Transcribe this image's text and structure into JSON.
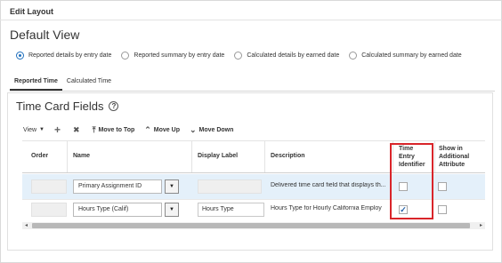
{
  "page": {
    "title": "Edit Layout",
    "view_title": "Default View"
  },
  "view_options": [
    {
      "label": "Reported details by entry date",
      "selected": true
    },
    {
      "label": "Reported summary by entry date",
      "selected": false
    },
    {
      "label": "Calculated details by earned date",
      "selected": false
    },
    {
      "label": "Calculated summary by earned date",
      "selected": false
    }
  ],
  "tabs": [
    {
      "label": "Reported Time",
      "active": true
    },
    {
      "label": "Calculated Time",
      "active": false
    }
  ],
  "section": {
    "title": "Time Card Fields",
    "help_icon": "?"
  },
  "toolbar": {
    "view_label": "View",
    "view_arrow": "▼",
    "add_icon": "+",
    "delete_icon": "✖",
    "move_top_icon": "⤒",
    "move_top_label": "Move to Top",
    "move_up_icon": "⌃",
    "move_up_label": "Move Up",
    "move_down_icon": "⌄",
    "move_down_label": "Move Down"
  },
  "table": {
    "columns": {
      "order": "Order",
      "name": "Name",
      "display_label": "Display Label",
      "description": "Description",
      "time_entry_identifier_1": "Time",
      "time_entry_identifier_2": "Entry",
      "time_entry_identifier_3": "Identifier",
      "show_additional_1": "Show in",
      "show_additional_2": "Additional",
      "show_additional_3": "Attribute"
    },
    "rows": [
      {
        "order": "",
        "name": "Primary Assignment ID",
        "display_label": "",
        "description": "Delivered time card field that displays th...",
        "time_entry_identifier": false,
        "show_additional": false,
        "selected": true
      },
      {
        "order": "",
        "name": "Hours Type (Calif)",
        "display_label": "Hours Type",
        "description": "Hours Type for Hourly California Employ",
        "time_entry_identifier": true,
        "show_additional": false,
        "selected": false
      }
    ],
    "dropdown_arrow": "▼",
    "check_glyph": "✓"
  },
  "scrollbar": {
    "left_arrow": "◂",
    "right_arrow": "▸"
  },
  "colors": {
    "accent": "#1f6fbd",
    "highlight": "#d9252a",
    "selected_row": "#e4f0fa"
  }
}
